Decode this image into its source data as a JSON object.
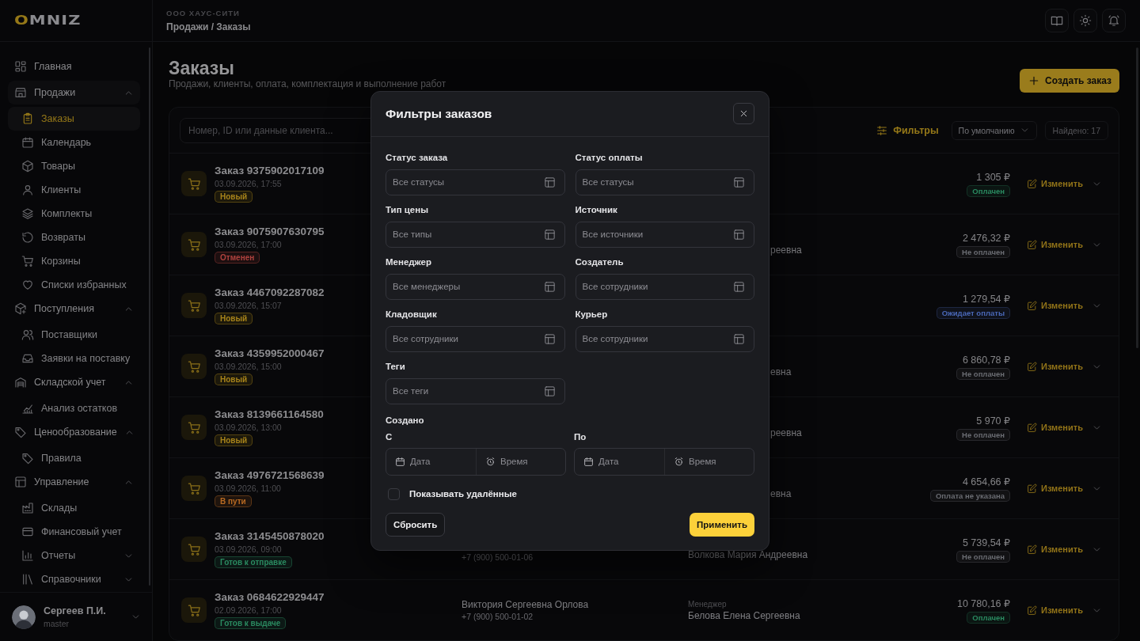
{
  "sidebar": {
    "logo": "OMNIZ",
    "nav": [
      {
        "label": "Главная",
        "selected": false
      },
      {
        "label": "Продажи",
        "selected": false,
        "expanded": true,
        "children": [
          {
            "label": "Заказы",
            "selected": true
          },
          {
            "label": "Календарь",
            "selected": false
          },
          {
            "label": "Товары",
            "selected": false
          },
          {
            "label": "Клиенты",
            "selected": false
          },
          {
            "label": "Комплекты",
            "selected": false
          },
          {
            "label": "Возвраты",
            "selected": false
          },
          {
            "label": "Корзины",
            "selected": false
          },
          {
            "label": "Списки избранных",
            "selected": false
          }
        ]
      },
      {
        "label": "Поступления",
        "selected": false,
        "expanded": true,
        "children": [
          {
            "label": "Поставщики",
            "selected": false
          },
          {
            "label": "Заявки на поставку",
            "selected": false
          }
        ]
      },
      {
        "label": "Складской учет",
        "selected": false,
        "expanded": true,
        "children": [
          {
            "label": "Анализ остатков",
            "selected": false
          }
        ]
      },
      {
        "label": "Ценообразование",
        "selected": false,
        "expanded": true,
        "children": [
          {
            "label": "Правила",
            "selected": false
          }
        ]
      },
      {
        "label": "Управление",
        "selected": false,
        "expanded": true,
        "children": [
          {
            "label": "Склады",
            "selected": false
          },
          {
            "label": "Финансовый учет",
            "selected": false
          },
          {
            "label": "Отчеты",
            "selected": false,
            "expanded": false
          },
          {
            "label": "Справочники",
            "selected": false,
            "expanded": false
          }
        ]
      }
    ],
    "user": {
      "name": "Сергеев П.И.",
      "role": "master"
    }
  },
  "header": {
    "company": "ООО ХАУС-СИТИ",
    "breadcrumb": "Продажи / Заказы"
  },
  "page": {
    "title": "Заказы",
    "subtitle": "Продажи, клиенты, оплата, комплектация и выполнение работ",
    "create_button": "Создать заказ",
    "search": {
      "placeholder": "Номер, ID или данные клиента..."
    },
    "filters_button": "Фильтры",
    "sort": "По умолчанию",
    "found": "Найдено: 17"
  },
  "orders": [
    {
      "title": "Заказ 9375902017109",
      "date": "03.09.2026, 17:55",
      "status": {
        "label": "Новый",
        "color": "#a8841a"
      },
      "amount": "1 305 ₽",
      "payment": {
        "label": "Оплачен",
        "color": "#2a8a60"
      },
      "edit": "Изменить"
    },
    {
      "title": "Заказ 9075907630795",
      "date": "03.09.2026, 17:00",
      "status": {
        "label": "Отменен",
        "color": "#b0423e"
      },
      "manager": {
        "kind": "partial",
        "name": "реевна"
      },
      "amount": "2 476,32 ₽",
      "payment": {
        "label": "Не оплачен",
        "color": "#6a6c72"
      },
      "edit": "Изменить"
    },
    {
      "title": "Заказ 4467092287082",
      "date": "03.09.2026, 15:07",
      "status": {
        "label": "Новый",
        "color": "#a8841a"
      },
      "amount": "1 279,54 ₽",
      "payment": {
        "label": "Ожидает оплаты",
        "color": "#4a68b8"
      },
      "edit": "Изменить"
    },
    {
      "title": "Заказ 4359952000467",
      "date": "03.09.2026, 15:00",
      "status": {
        "label": "Новый",
        "color": "#a8841a"
      },
      "manager": {
        "kind": "partial",
        "name": "евна"
      },
      "amount": "6 860,78 ₽",
      "payment": {
        "label": "Не оплачен",
        "color": "#6a6c72"
      },
      "edit": "Изменить"
    },
    {
      "title": "Заказ 8139661164580",
      "date": "03.09.2026, 13:00",
      "status": {
        "label": "Новый",
        "color": "#a8841a"
      },
      "manager": {
        "kind": "partial",
        "name": "реевна"
      },
      "amount": "5 970 ₽",
      "payment": {
        "label": "Не оплачен",
        "color": "#6a6c72"
      },
      "edit": "Изменить"
    },
    {
      "title": "Заказ 4976721568639",
      "date": "03.09.2026, 11:00",
      "status": {
        "label": "В пути",
        "color": "#b86a22"
      },
      "manager": {
        "kind": "partial",
        "name": "евна"
      },
      "amount": "4 654,66 ₽",
      "payment": {
        "label": "Оплата не указана",
        "color": "#6a6c72"
      },
      "edit": "Изменить"
    },
    {
      "title": "Заказ 3145450878020",
      "date": "03.09.2026, 09:00",
      "status": {
        "label": "Готов к отправке",
        "color": "#2a8a60"
      },
      "client": {
        "phone": "+7 (900) 500-01-06"
      },
      "manager": {
        "kind": "full",
        "name": "Волкова Мария Андреевна"
      },
      "amount": "5 739,54 ₽",
      "payment": {
        "label": "Не оплачен",
        "color": "#6a6c72"
      },
      "edit": "Изменить"
    },
    {
      "title": "Заказ 0684622929447",
      "date": "02.09.2026, 17:00",
      "status": {
        "label": "Готов к выдаче",
        "color": "#2a8a60"
      },
      "client": {
        "name": "Виктория Сергеевна Орлова",
        "phone": "+7 (900) 500-01-02"
      },
      "manager": {
        "kind": "full",
        "label": "Менеджер",
        "name": "Белова Елена Сергеевна"
      },
      "amount": "10 780,16 ₽",
      "payment": {
        "label": "Оплачен",
        "color": "#2a8a60"
      },
      "edit": "Изменить"
    }
  ],
  "modal": {
    "title": "Фильтры заказов",
    "fields": [
      {
        "label": "Статус заказа",
        "placeholder": "Все статусы"
      },
      {
        "label": "Статус оплаты",
        "placeholder": "Все статусы"
      },
      {
        "label": "Тип цены",
        "placeholder": "Все типы"
      },
      {
        "label": "Источник",
        "placeholder": "Все источники"
      },
      {
        "label": "Менеджер",
        "placeholder": "Все менеджеры"
      },
      {
        "label": "Создатель",
        "placeholder": "Все сотрудники"
      },
      {
        "label": "Кладовщик",
        "placeholder": "Все сотрудники"
      },
      {
        "label": "Курьер",
        "placeholder": "Все сотрудники"
      },
      {
        "label": "Теги",
        "placeholder": "Все теги"
      }
    ],
    "created_label": "Создано",
    "ranges": [
      {
        "label": "С",
        "date_placeholder": "Дата",
        "time_placeholder": "Время"
      },
      {
        "label": "По",
        "date_placeholder": "Дата",
        "time_placeholder": "Время"
      }
    ],
    "show_deleted": {
      "label": "Показывать удалённые",
      "checked": false
    },
    "reset_button": "Сбросить",
    "apply_button": "Применить"
  }
}
